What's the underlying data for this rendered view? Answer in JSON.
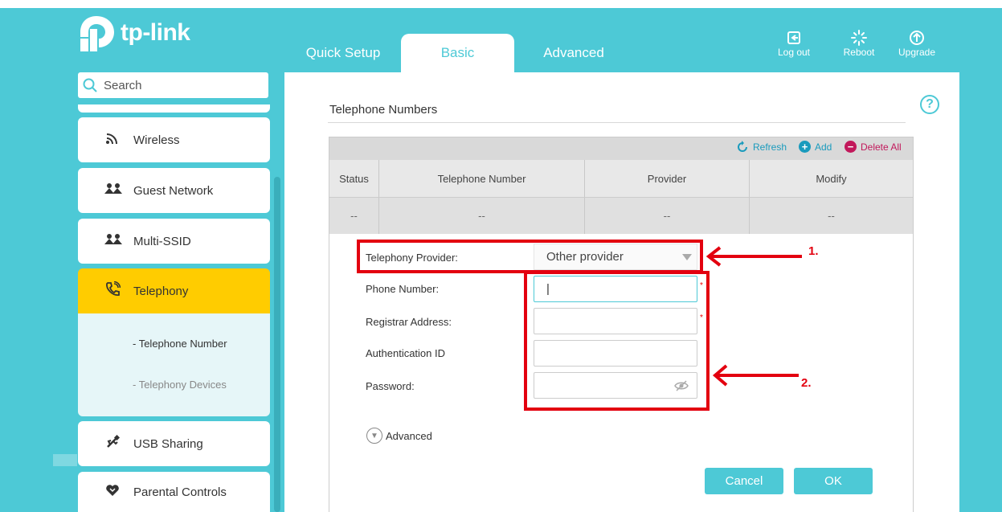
{
  "brand": {
    "logo_text": "tp-link"
  },
  "tabs": [
    {
      "label": "Quick Setup"
    },
    {
      "label": "Basic"
    },
    {
      "label": "Advanced"
    }
  ],
  "top_actions": {
    "logout": {
      "label": "Log out",
      "icon": "logout-icon"
    },
    "reboot": {
      "label": "Reboot",
      "icon": "reboot-icon"
    },
    "upgrade": {
      "label": "Upgrade",
      "icon": "upgrade-icon"
    }
  },
  "sidebar": {
    "search_placeholder": "Search",
    "items": [
      {
        "label": "Wireless",
        "icon": "wifi-icon"
      },
      {
        "label": "Guest Network",
        "icon": "guest-network-icon"
      },
      {
        "label": "Multi-SSID",
        "icon": "multi-ssid-icon"
      },
      {
        "label": "Telephony",
        "icon": "telephony-icon",
        "active": true
      },
      {
        "label": "USB Sharing",
        "icon": "usb-icon"
      },
      {
        "label": "Parental Controls",
        "icon": "heart-icon"
      }
    ],
    "sub_items": [
      {
        "label": "- Telephone Number",
        "active": true
      },
      {
        "label": "- Telephony Devices",
        "active": false
      }
    ]
  },
  "main": {
    "section_title": "Telephone Numbers",
    "toolbar": {
      "refresh": "Refresh",
      "add": "Add",
      "delete_all": "Delete All"
    },
    "table": {
      "headers": [
        "Status",
        "Telephone Number",
        "Provider",
        "Modify"
      ],
      "row": [
        "--",
        "--",
        "--",
        "--"
      ]
    },
    "form": {
      "provider_label": "Telephony Provider:",
      "provider_value": "Other provider",
      "phone_label": "Phone Number:",
      "phone_value": "",
      "registrar_label": "Registrar Address:",
      "registrar_value": "",
      "auth_label": "Authentication ID",
      "auth_value": "",
      "password_label": "Password:",
      "password_value": "",
      "required_mark": "*",
      "advanced_label": "Advanced"
    },
    "buttons": {
      "cancel": "Cancel",
      "ok": "OK"
    }
  },
  "annotations": {
    "first": "1.",
    "second": "2."
  },
  "colors": {
    "teal": "#4dc9d6",
    "active_yellow": "#ffcc00",
    "annotation_red": "#e3000f",
    "add_green": "#1a9bbd",
    "delete_red": "#c2185b"
  }
}
